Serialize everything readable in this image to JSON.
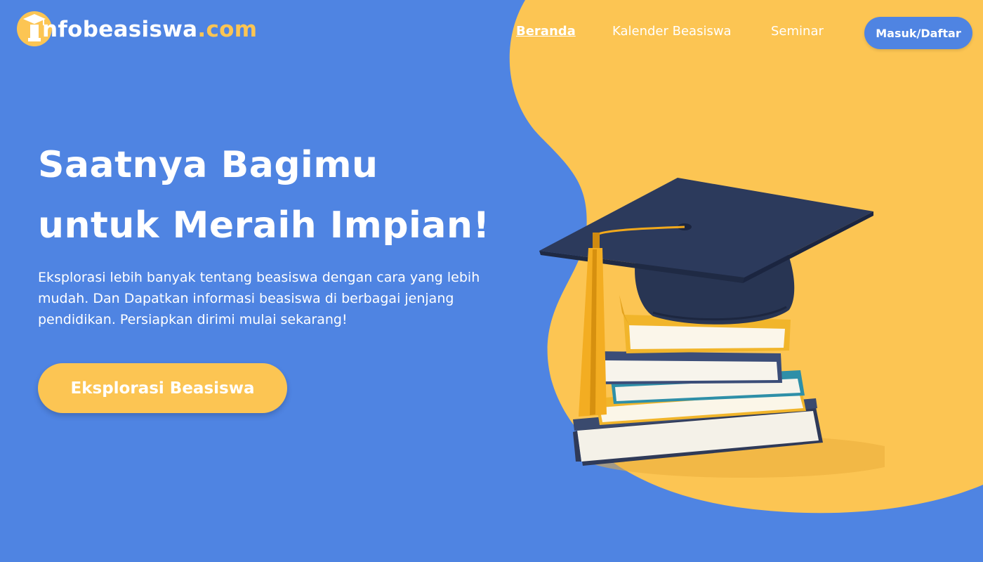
{
  "brand": {
    "name_main": "nfobeasiswa",
    "name_suffix": ".com",
    "mark_letter": "i"
  },
  "nav": {
    "items": [
      {
        "label": "Beranda",
        "active": true
      },
      {
        "label": "Kalender Beasiswa",
        "active": false
      },
      {
        "label": "Seminar",
        "active": false
      }
    ],
    "login_label": "Masuk/Daftar"
  },
  "hero": {
    "title_line1": "Saatnya Bagimu",
    "title_line2": "untuk Meraih Impian!",
    "description": "Eksplorasi lebih banyak tentang beasiswa dengan cara yang lebih mudah. Dan Dapatkan informasi beasiswa di berbagai jenjang pendidikan. Persiapkan dirimi mulai sekarang!",
    "cta_label": "Eksplorasi  Beasiswa"
  },
  "icons": {
    "logo": "graduation-cap-icon",
    "illustration": "graduation-cap-books-illustration"
  },
  "colors": {
    "background": "#4f84e2",
    "accent": "#fcc553",
    "text": "#ffffff"
  }
}
